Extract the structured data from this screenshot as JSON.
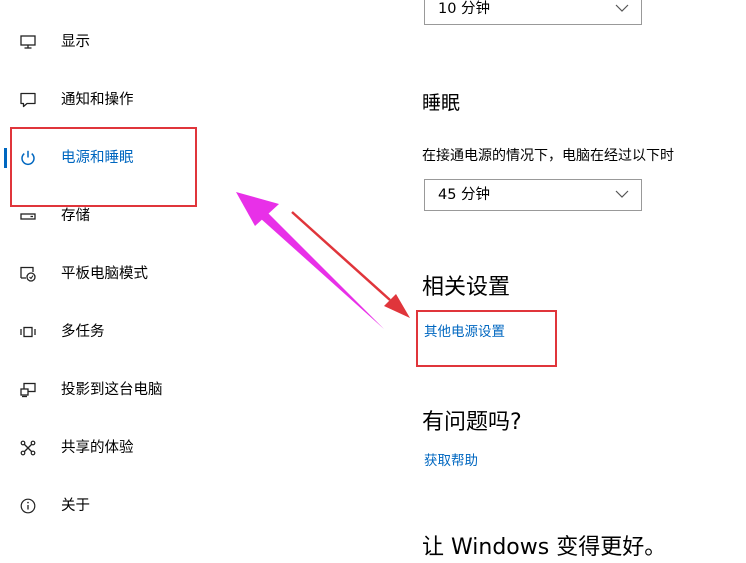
{
  "sidebar": {
    "items": [
      {
        "label": "显示",
        "icon": "monitor-icon",
        "active": false
      },
      {
        "label": "通知和操作",
        "icon": "message-icon",
        "active": false
      },
      {
        "label": "电源和睡眠",
        "icon": "power-icon",
        "active": true
      },
      {
        "label": "存储",
        "icon": "storage-drive-icon",
        "active": false
      },
      {
        "label": "平板电脑模式",
        "icon": "tablet-mode-icon",
        "active": false
      },
      {
        "label": "多任务",
        "icon": "multitasking-icon",
        "active": false
      },
      {
        "label": "投影到这台电脑",
        "icon": "project-icon",
        "active": false
      },
      {
        "label": "共享的体验",
        "icon": "shared-experiences-icon",
        "active": false
      },
      {
        "label": "关于",
        "icon": "info-icon",
        "active": false
      }
    ]
  },
  "main": {
    "screen_timeout": {
      "value": "10 分钟"
    },
    "sleep": {
      "heading": "睡眠",
      "description": "在接通电源的情况下，电脑在经过以下时",
      "value": "45 分钟"
    },
    "related": {
      "heading": "相关设置",
      "link": "其他电源设置"
    },
    "help": {
      "heading": "有问题吗?",
      "link": "获取帮助"
    },
    "feedback": {
      "heading": "让 Windows 变得更好。"
    }
  },
  "colors": {
    "accent": "#0067c0",
    "annotation_red": "#e0353b",
    "annotation_magenta": "#e830e8"
  }
}
